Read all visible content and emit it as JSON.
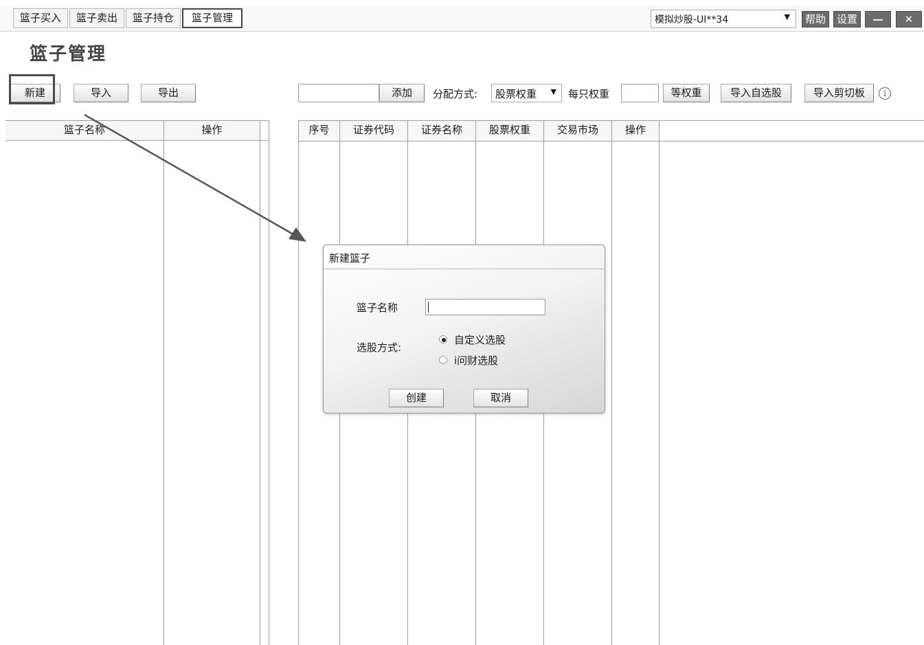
{
  "tabs": [
    {
      "label": "篮子买入"
    },
    {
      "label": "篮子卖出"
    },
    {
      "label": "篮子持仓"
    },
    {
      "label": "篮子管理"
    }
  ],
  "header": {
    "account_select": "模拟炒股-UI**34",
    "help_label": "帮助",
    "settings_label": "设置",
    "minimize_glyph": "—",
    "close_glyph": "✕"
  },
  "page_title": "篮子管理",
  "toolbar": {
    "new_label": "新建",
    "import_label": "导入",
    "export_label": "导出",
    "add_label": "添加",
    "allocation_label": "分配方式:",
    "allocation_value": "股票权重",
    "per_weight_label": "每只权重",
    "equal_weight_label": "等权重",
    "import_watchlist_label": "导入自选股",
    "import_clipboard_label": "导入剪切板"
  },
  "left_table": {
    "columns": [
      "篮子名称",
      "操作"
    ]
  },
  "right_table": {
    "columns": [
      "序号",
      "证券代码",
      "证券名称",
      "股票权重",
      "交易市场",
      "操作"
    ]
  },
  "dialog": {
    "title": "新建篮子",
    "name_label": "篮子名称",
    "method_label": "选股方式:",
    "options": [
      {
        "label": "自定义选股",
        "selected": true
      },
      {
        "label": "i问财选股",
        "selected": false
      }
    ],
    "create_label": "创建",
    "cancel_label": "取消"
  }
}
